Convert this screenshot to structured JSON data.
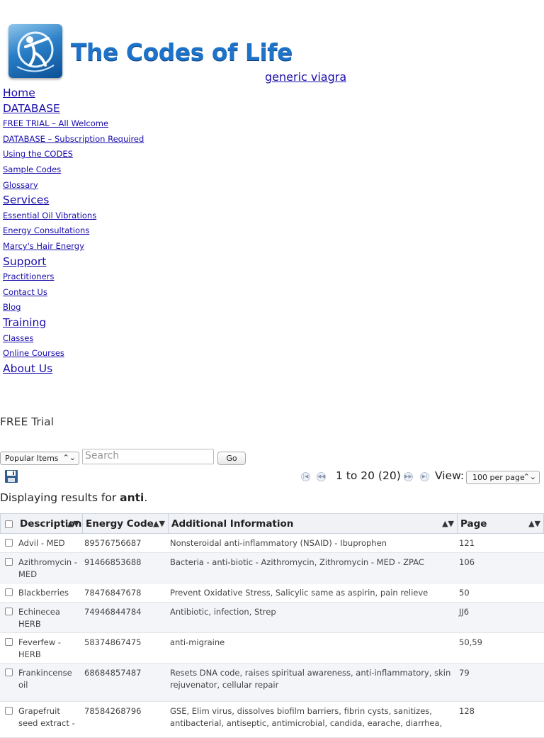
{
  "header": {
    "logo_text": "The Codes of Life",
    "sponsor_link": "generic viagra"
  },
  "nav": [
    {
      "label": "Home",
      "size": "big"
    },
    {
      "label": "DATABASE",
      "size": "big"
    },
    {
      "label": "FREE TRIAL – All Welcome",
      "size": "small"
    },
    {
      "label": "DATABASE – Subscription Required",
      "size": "small"
    },
    {
      "label": "Using the CODES",
      "size": "small"
    },
    {
      "label": "Sample Codes",
      "size": "small"
    },
    {
      "label": "Glossary",
      "size": "small"
    },
    {
      "label": "Services",
      "size": "big"
    },
    {
      "label": "Essential Oil Vibrations",
      "size": "small"
    },
    {
      "label": "Energy Consultations",
      "size": "small"
    },
    {
      "label": "Marcy's Hair Energy",
      "size": "small"
    },
    {
      "label": "Support",
      "size": "big"
    },
    {
      "label": "Practitioners",
      "size": "small"
    },
    {
      "label": "Contact Us",
      "size": "small"
    },
    {
      "label": "Blog",
      "size": "small"
    },
    {
      "label": "Training",
      "size": "big"
    },
    {
      "label": "Classes",
      "size": "small"
    },
    {
      "label": "Online Courses",
      "size": "small"
    },
    {
      "label": "About Us",
      "size": "big"
    }
  ],
  "section_title": "FREE Trial",
  "toolbar": {
    "filter_selected": "Popular Items",
    "search_placeholder": "Search",
    "go_label": "Go"
  },
  "pager": {
    "range_text": "1 to 20 (20)",
    "view_label": "View:",
    "per_page_selected": "100 per page"
  },
  "results": {
    "prefix": "Displaying results for ",
    "query": "anti",
    "suffix": "."
  },
  "table": {
    "columns": [
      "Description",
      "Energy Code",
      "Additional Information",
      "Page"
    ],
    "rows": [
      {
        "desc": "Advil - MED",
        "code": "89576756687",
        "info": "Nonsteroidal anti-inflammatory (NSAID) - Ibuprophen",
        "page": "121"
      },
      {
        "desc": "Azithromycin - MED",
        "code": "91466853688",
        "info": "Bacteria - anti-biotic - Azithromycin, Zithromycin - MED - ZPAC",
        "page": "106"
      },
      {
        "desc": "Blackberries",
        "code": "78476847678",
        "info": "Prevent Oxidative Stress, Salicylic same as aspirin, pain relieve",
        "page": "50"
      },
      {
        "desc": "Echinecea HERB",
        "code": "74946844784",
        "info": "Antibiotic, infection, Strep",
        "page": "JJ6"
      },
      {
        "desc": "Feverfew - HERB",
        "code": "58374867475",
        "info": "anti-migraine",
        "page": "50,59"
      },
      {
        "desc": "Frankincense oil",
        "code": "68684857487",
        "info": "Resets DNA code, raises spiritual awareness, anti-inflammatory, skin rejuvenator, cellular repair",
        "page": "79"
      },
      {
        "desc": "Grapefruit seed extract -",
        "code": "78584268796",
        "info": "GSE, Elim virus, dissolves biofilm barriers, fibrin cysts, sanitizes, antibacterial, antiseptic, antimicrobial, candida, earache, diarrhea,",
        "page": "128"
      }
    ]
  }
}
